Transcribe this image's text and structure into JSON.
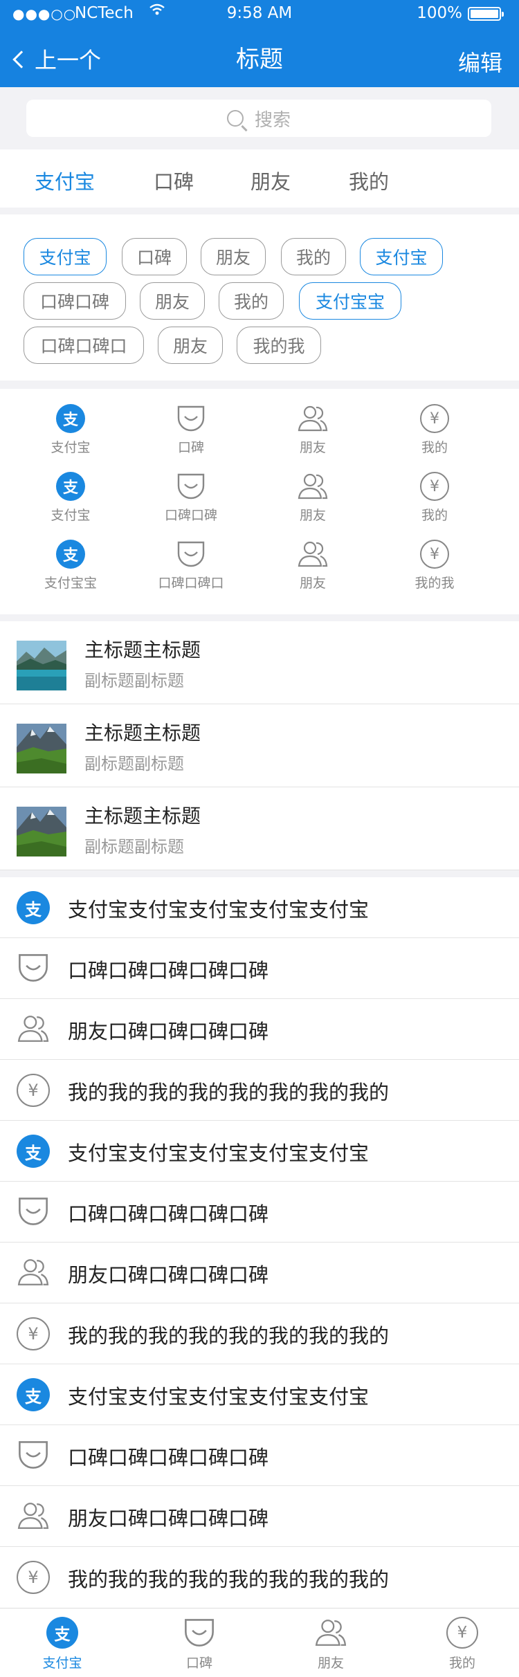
{
  "status_bar": {
    "signal": "●●●○○",
    "carrier": "NCTech",
    "time": "9:58 AM",
    "battery": "100%"
  },
  "nav": {
    "back_label": "上一个",
    "title": "标题",
    "edit_label": "编辑"
  },
  "search": {
    "placeholder": "搜索"
  },
  "tabs": [
    {
      "label": "支付宝",
      "active": true
    },
    {
      "label": "口碑"
    },
    {
      "label": "朋友"
    },
    {
      "label": "我的"
    }
  ],
  "chips": [
    {
      "label": "支付宝",
      "active": true
    },
    {
      "label": "口碑"
    },
    {
      "label": "朋友"
    },
    {
      "label": "我的"
    },
    {
      "label": "支付宝",
      "active": true
    },
    {
      "label": "口碑口碑"
    },
    {
      "label": "朋友"
    },
    {
      "label": "我的"
    },
    {
      "label": "支付宝宝",
      "active": true
    },
    {
      "label": "口碑口碑口"
    },
    {
      "label": "朋友"
    },
    {
      "label": "我的我"
    }
  ],
  "grid": [
    {
      "icon": "alipay-icon",
      "label": "支付宝"
    },
    {
      "icon": "koubei-icon",
      "label": "口碑"
    },
    {
      "icon": "friends-icon",
      "label": "朋友"
    },
    {
      "icon": "yen-icon",
      "label": "我的"
    },
    {
      "icon": "alipay-icon",
      "label": "支付宝"
    },
    {
      "icon": "koubei-icon",
      "label": "口碑口碑"
    },
    {
      "icon": "friends-icon",
      "label": "朋友"
    },
    {
      "icon": "yen-icon",
      "label": "我的"
    },
    {
      "icon": "alipay-icon",
      "label": "支付宝宝"
    },
    {
      "icon": "koubei-icon",
      "label": "口碑口碑口"
    },
    {
      "icon": "friends-icon",
      "label": "朋友"
    },
    {
      "icon": "yen-icon",
      "label": "我的我"
    }
  ],
  "media_list": [
    {
      "title": "主标题主标题",
      "subtitle": "副标题副标题",
      "image": "lake-mountain-thumbnail"
    },
    {
      "title": "主标题主标题",
      "subtitle": "副标题副标题",
      "image": "mountain-valley-thumbnail"
    },
    {
      "title": "主标题主标题",
      "subtitle": "副标题副标题",
      "image": "mountain-valley-thumbnail"
    }
  ],
  "list": [
    {
      "icon": "alipay-icon",
      "text": "支付宝支付宝支付宝支付宝支付宝"
    },
    {
      "icon": "koubei-icon",
      "text": "口碑口碑口碑口碑口碑"
    },
    {
      "icon": "friends-icon",
      "text": "朋友口碑口碑口碑口碑"
    },
    {
      "icon": "yen-icon",
      "text": "我的我的我的我的我的我的我的我的"
    },
    {
      "icon": "alipay-icon",
      "text": "支付宝支付宝支付宝支付宝支付宝"
    },
    {
      "icon": "koubei-icon",
      "text": "口碑口碑口碑口碑口碑"
    },
    {
      "icon": "friends-icon",
      "text": "朋友口碑口碑口碑口碑"
    },
    {
      "icon": "yen-icon",
      "text": "我的我的我的我的我的我的我的我的"
    },
    {
      "icon": "alipay-icon",
      "text": "支付宝支付宝支付宝支付宝支付宝"
    },
    {
      "icon": "koubei-icon",
      "text": "口碑口碑口碑口碑口碑"
    },
    {
      "icon": "friends-icon",
      "text": "朋友口碑口碑口碑口碑"
    },
    {
      "icon": "yen-icon",
      "text": "我的我的我的我的我的我的我的我的"
    }
  ],
  "tab_bar": [
    {
      "icon": "alipay-icon",
      "label": "支付宝",
      "active": true
    },
    {
      "icon": "koubei-icon",
      "label": "口碑"
    },
    {
      "icon": "friends-icon",
      "label": "朋友"
    },
    {
      "icon": "yen-icon",
      "label": "我的"
    }
  ],
  "glyphs": {
    "alipay": "支",
    "yen": "¥"
  },
  "colors": {
    "accent": "#1682e0",
    "text": "#222222",
    "muted": "#999999",
    "background": "#f2f2f5"
  }
}
